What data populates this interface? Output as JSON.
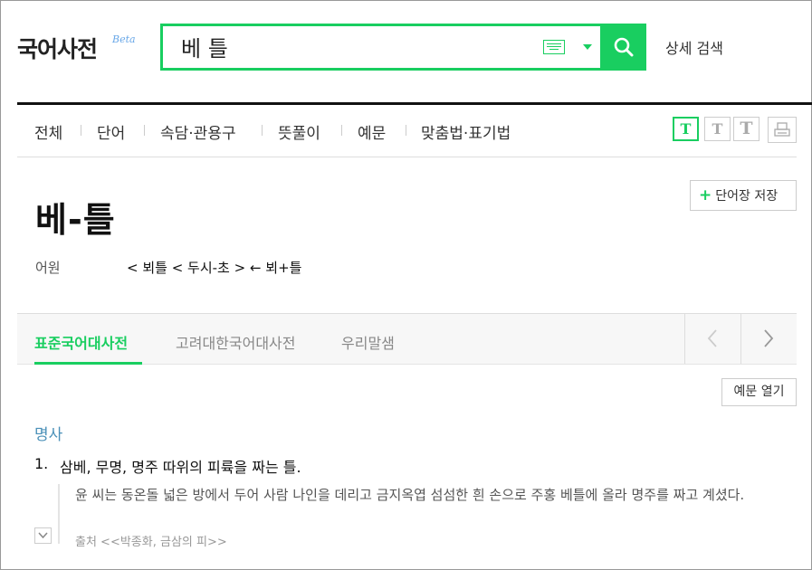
{
  "header": {
    "logo": "국어사전",
    "beta": "Beta",
    "search_value": "베 틀",
    "advanced_search": "상세 검색"
  },
  "tabs": [
    "전체",
    "단어",
    "속담·관용구",
    "뜻풀이",
    "예문",
    "맞춤법·표기법"
  ],
  "font_size_buttons": [
    "T",
    "T",
    "T"
  ],
  "entry": {
    "save_label": "단어장 저장",
    "headword": "베-틀",
    "etymology_label": "어원",
    "etymology_value": "< 뵈틀 < 두시-초 > ← 뵈+틀"
  },
  "dict_tabs": [
    "표준국어대사전",
    "고려대한국어대사전",
    "우리말샘"
  ],
  "examples_toggle": "예문 열기",
  "sense": {
    "pos": "명사",
    "number": "1.",
    "definition": "삼베, 무명, 명주 따위의 피륙을 짜는 틀.",
    "example": "윤 씨는 동온돌 넓은 방에서 두어 사람 나인을 데리고 금지옥엽 섬섬한 흰 손으로 주홍 베틀에 올라 명주를 짜고 계셨다.",
    "source": "출처 <<박종화, 금삼의 피>>"
  },
  "colors": {
    "accent": "#19ce60",
    "pos": "#4a90b8"
  }
}
